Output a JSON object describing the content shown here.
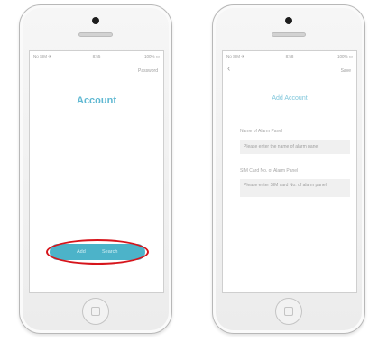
{
  "left_screen": {
    "status": {
      "carrier": "No SIM ✈",
      "time": "8:55",
      "battery": "100% ▭"
    },
    "nav_right": "Password",
    "title": "Account",
    "button_left": "Add",
    "button_right": "Search"
  },
  "right_screen": {
    "status": {
      "carrier": "No SIM ✈",
      "time": "8:58",
      "battery": "100% ▭"
    },
    "back_icon": "‹",
    "nav_right": "Save",
    "title": "Add Account",
    "name_label": "Name of Alarm Panel",
    "name_placeholder": "Please enter the name of alarm panel",
    "sim_label": "SIM Card No. of Alarm Panel",
    "sim_placeholder": "Please enter SIM card No. of alarm panel"
  },
  "colors": {
    "accent": "#4cb3c9",
    "title": "#5fb8d2",
    "highlight": "#d6141b"
  },
  "icons": [
    "camera-icon",
    "speaker-icon",
    "home-button-icon",
    "back-icon"
  ]
}
